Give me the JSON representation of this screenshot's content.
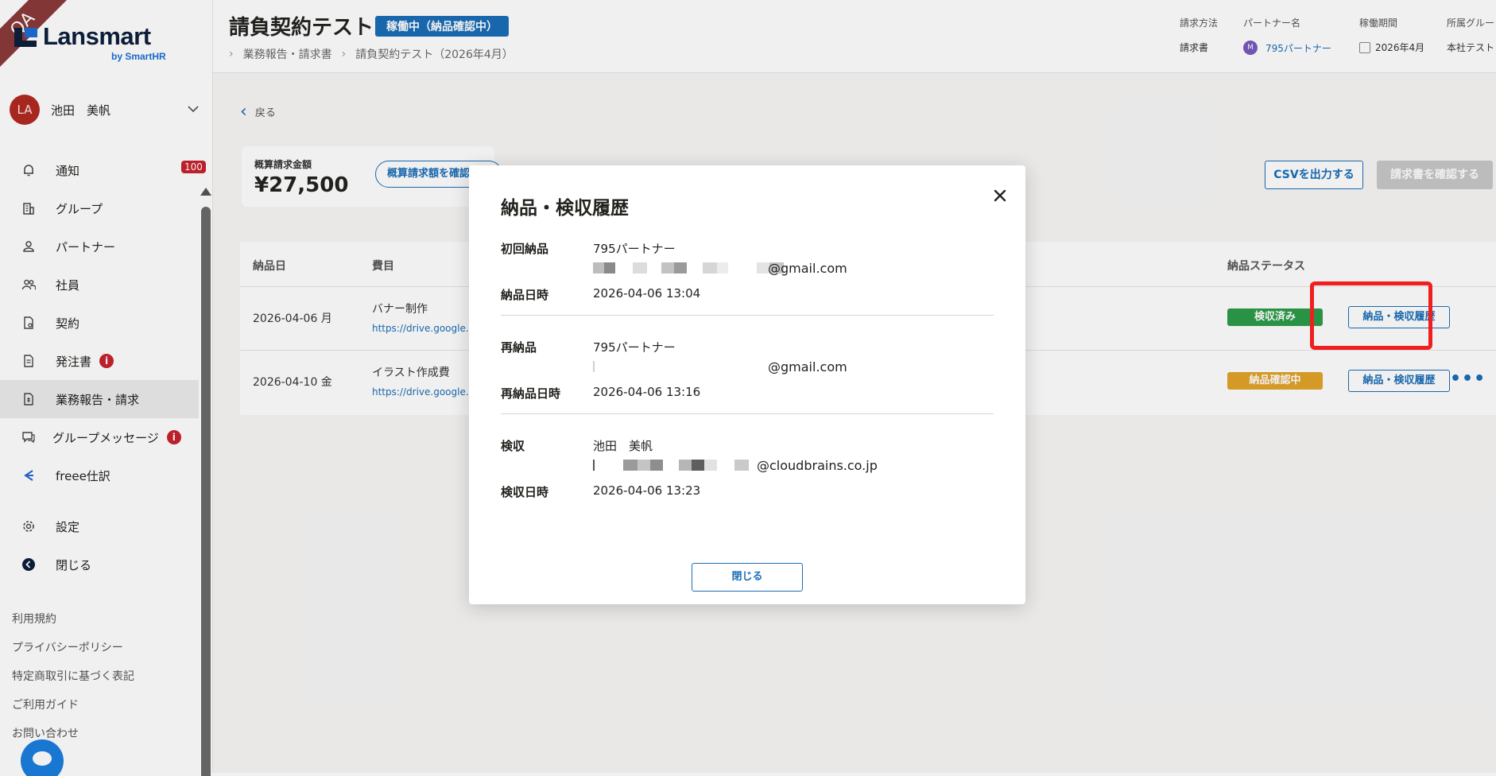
{
  "ribbon": "QA",
  "brand": {
    "name": "Lansmart",
    "sub": "by SmartHR"
  },
  "user": {
    "initials": "LA",
    "name": "池田　美帆"
  },
  "nav": [
    {
      "label": "通知",
      "icon": "bell-icon",
      "badge": "100"
    },
    {
      "label": "グループ",
      "icon": "building-icon"
    },
    {
      "label": "パートナー",
      "icon": "person-icon"
    },
    {
      "label": "社員",
      "icon": "people-icon"
    },
    {
      "label": "契約",
      "icon": "contract-icon"
    },
    {
      "label": "発注書",
      "icon": "order-doc-icon",
      "alert": "i"
    },
    {
      "label": "業務報告・請求",
      "icon": "report-doc-icon",
      "active": true
    },
    {
      "label": "グループメッセージ",
      "icon": "message-icon",
      "alert": "i"
    },
    {
      "label": "freee仕訳",
      "icon": "freee-icon"
    }
  ],
  "nav_bottom": [
    {
      "label": "設定",
      "icon": "gear-icon"
    },
    {
      "label": "閉じる",
      "icon": "collapse-icon"
    }
  ],
  "footer_links": [
    "利用規約",
    "プライバシーポリシー",
    "特定商取引に基づく表記",
    "ご利用ガイド",
    "お問い合わせ"
  ],
  "header": {
    "title": "請負契約テスト",
    "status": "稼働中（納品確認中）",
    "breadcrumb": [
      "業務報告・請求書",
      "請負契約テスト（2026年4月）"
    ],
    "meta": {
      "billing_method_label": "請求方法",
      "billing_method_value": "請求書",
      "partner_label": "パートナー名",
      "partner_avatar": "M",
      "partner_value": "795パートナー",
      "period_label": "稼働期間",
      "period_value": "2026年4月",
      "group_label": "所属グルー",
      "group_value": "本社テスト"
    }
  },
  "back_label": "戻る",
  "amount": {
    "label": "概算請求金額",
    "value": "¥27,500",
    "button": "概算請求額を確認する"
  },
  "actions": {
    "csv": "CSVを出力する",
    "invoice": "請求書を確認する"
  },
  "table": {
    "headers": {
      "date": "納品日",
      "item": "費目",
      "status": "納品ステータス"
    },
    "rows": [
      {
        "date": "2026-04-06 月",
        "item": "バナー制作",
        "link": "https://drive.google.c",
        "status": "検収済み",
        "status_color": "#2d9c4a",
        "button": "納品・検収履歴"
      },
      {
        "date": "2026-04-10 金",
        "item": "イラスト作成費",
        "link": "https://drive.google.c",
        "status": "納品確認中",
        "status_color": "#e3a328",
        "button": "納品・検収履歴",
        "more": "•••"
      }
    ]
  },
  "modal": {
    "title": "納品・検収履歴",
    "close_label": "閉じる",
    "first_delivery": {
      "label": "初回納品",
      "name": "795パートナー",
      "email_suffix": "@gmail.com"
    },
    "delivery_datetime": {
      "label": "納品日時",
      "value": "2026-04-06 13:04"
    },
    "redelivery": {
      "label": "再納品",
      "name": "795パートナー",
      "email_suffix": "@gmail.com"
    },
    "redelivery_datetime": {
      "label": "再納品日時",
      "value": "2026-04-06 13:16"
    },
    "inspection": {
      "label": "検収",
      "name": "池田　美帆",
      "email_suffix": "@cloudbrains.co.jp"
    },
    "inspection_datetime": {
      "label": "検収日時",
      "value": "2026-04-06 13:23"
    }
  },
  "colors": {
    "accent": "#1a6eb7",
    "highlight": "#f01e1e",
    "danger": "#c8222d"
  }
}
